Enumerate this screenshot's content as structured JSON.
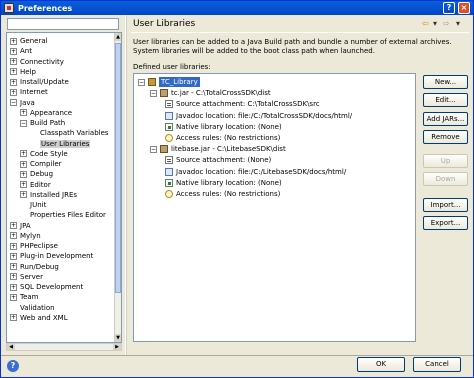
{
  "window": {
    "title": "Preferences",
    "controls": [
      "?",
      "×"
    ]
  },
  "filter": {
    "value": ""
  },
  "left_tree": {
    "items": [
      {
        "label": "General",
        "expander": "+"
      },
      {
        "label": "Ant",
        "expander": "+"
      },
      {
        "label": "Connectivity",
        "expander": "+"
      },
      {
        "label": "Help",
        "expander": "+"
      },
      {
        "label": "Install/Update",
        "expander": "+"
      },
      {
        "label": "Internet",
        "expander": "+"
      },
      {
        "label": "Java",
        "expander": "−"
      },
      {
        "label": "Appearance",
        "expander": "+"
      },
      {
        "label": "Build Path",
        "expander": "−"
      },
      {
        "label": "Classpath Variables",
        "expander": ""
      },
      {
        "label": "User Libraries",
        "expander": ""
      },
      {
        "label": "Code Style",
        "expander": "+"
      },
      {
        "label": "Compiler",
        "expander": "+"
      },
      {
        "label": "Debug",
        "expander": "+"
      },
      {
        "label": "Editor",
        "expander": "+"
      },
      {
        "label": "Installed JREs",
        "expander": "+"
      },
      {
        "label": "JUnit",
        "expander": ""
      },
      {
        "label": "Properties Files Editor",
        "expander": ""
      },
      {
        "label": "JPA",
        "expander": "+"
      },
      {
        "label": "Mylyn",
        "expander": "+"
      },
      {
        "label": "PHPeclipse",
        "expander": "+"
      },
      {
        "label": "Plug-in Development",
        "expander": "+"
      },
      {
        "label": "Run/Debug",
        "expander": "+"
      },
      {
        "label": "Server",
        "expander": "+"
      },
      {
        "label": "SQL Development",
        "expander": "+"
      },
      {
        "label": "Team",
        "expander": "+"
      },
      {
        "label": "Validation",
        "expander": ""
      },
      {
        "label": "Web and XML",
        "expander": "+"
      }
    ],
    "selected": "User Libraries"
  },
  "page": {
    "title": "User Libraries",
    "nav_back": "⇦",
    "nav_menu": "▾",
    "nav_fwd": "⇨",
    "nav_menu2": "▾",
    "description": "User libraries can be added to a Java Build path and bundle a number of external archives. System libraries will be added to the boot class path when launched.",
    "defined_label": "Defined user libraries:"
  },
  "lib_tree": {
    "items": [
      {
        "label": "TC_Library",
        "expander": "−",
        "icon": "library-icon"
      },
      {
        "label": "tc.jar - C:\\TotalCrossSDK\\dist",
        "expander": "−",
        "icon": "jar-icon"
      },
      {
        "label": "Source attachment: C:\\TotalCrossSDK\\src",
        "expander": "",
        "icon": "source-icon"
      },
      {
        "label": "Javadoc location: file:/C:/TotalCrossSDK/docs/html/",
        "expander": "",
        "icon": "javadoc-icon"
      },
      {
        "label": "Native library location: (None)",
        "expander": "",
        "icon": "native-library-icon"
      },
      {
        "label": "Access rules: (No restrictions)",
        "expander": "",
        "icon": "access-rules-icon"
      },
      {
        "label": "litebase.jar - C:\\LitebaseSDK\\dist",
        "expander": "−",
        "icon": "jar-icon"
      },
      {
        "label": "Source attachment: (None)",
        "expander": "",
        "icon": "source-icon"
      },
      {
        "label": "Javadoc location: file:/C:/LitebaseSDK/docs/html/",
        "expander": "",
        "icon": "javadoc-icon"
      },
      {
        "label": "Native library location: (None)",
        "expander": "",
        "icon": "native-library-icon"
      },
      {
        "label": "Access rules: (No restrictions)",
        "expander": "",
        "icon": "access-rules-icon"
      }
    ]
  },
  "buttons": {
    "new": "New...",
    "edit": "Edit...",
    "add_jars": "Add JARs...",
    "remove": "Remove",
    "up": "Up",
    "down": "Down",
    "import": "Import...",
    "export": "Export..."
  },
  "footer": {
    "help": "?",
    "ok": "OK",
    "cancel": "Cancel"
  }
}
